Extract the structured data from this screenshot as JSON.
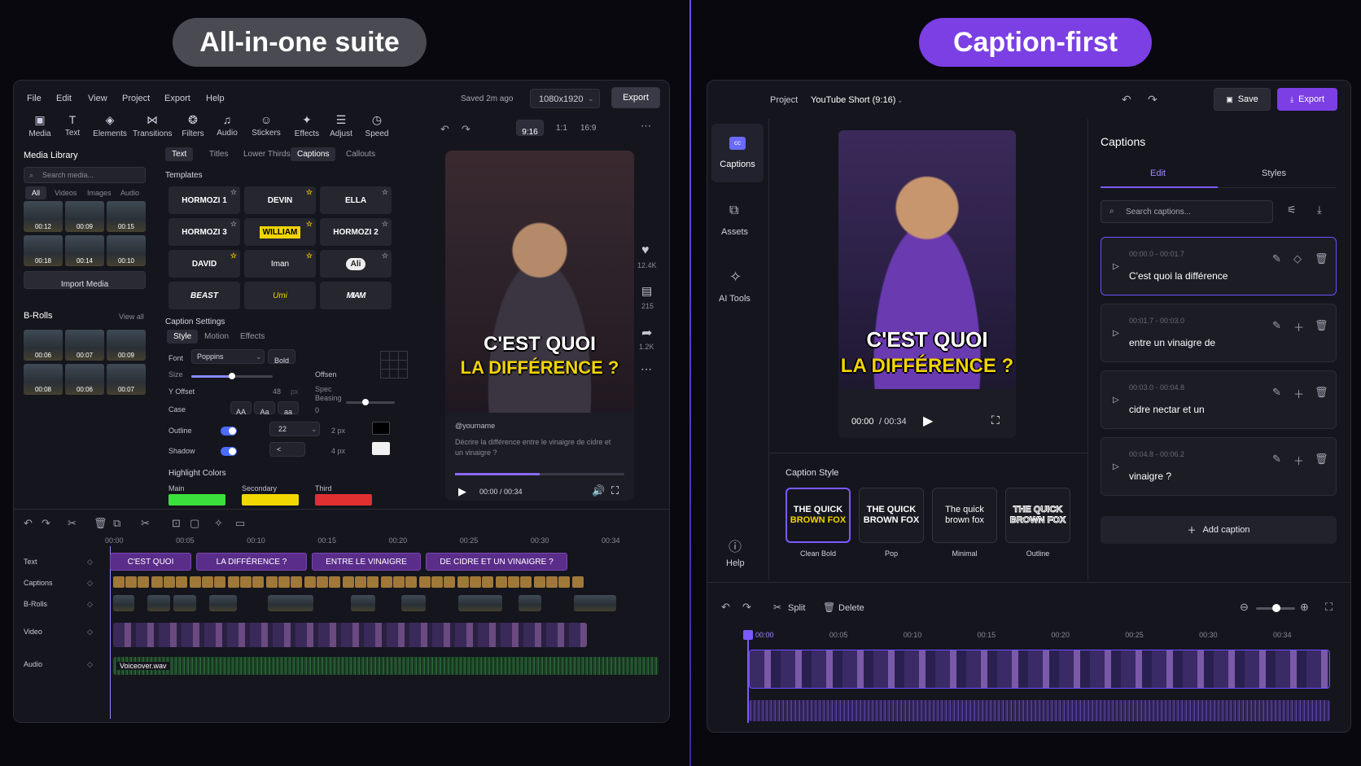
{
  "headers": {
    "left": "All-in-one suite",
    "right": "Caption-first"
  },
  "colors": {
    "accent": "#6a4fff",
    "accent_alt": "#7b3fe4",
    "main_highlight": "#3ce03c",
    "secondary_highlight": "#f0d800",
    "third_highlight": "#e03030"
  },
  "left": {
    "menu": [
      "File",
      "Edit",
      "View",
      "Project",
      "Export",
      "Help"
    ],
    "saved": "Saved 2m ago",
    "resolution": "1080x1920",
    "export_label": "Export",
    "tools": [
      {
        "label": "Media",
        "icon": "media-icon"
      },
      {
        "label": "Text",
        "icon": "text-icon"
      },
      {
        "label": "Elements",
        "icon": "elements-icon"
      },
      {
        "label": "Transitions",
        "icon": "transitions-icon"
      },
      {
        "label": "Filters",
        "icon": "filters-icon"
      },
      {
        "label": "Audio",
        "icon": "audio-icon"
      },
      {
        "label": "Stickers",
        "icon": "stickers-icon"
      },
      {
        "label": "Effects",
        "icon": "effects-icon"
      },
      {
        "label": "Adjust",
        "icon": "adjust-icon"
      },
      {
        "label": "Speed",
        "icon": "speed-icon"
      }
    ],
    "aspect": [
      "9:16",
      "1:1",
      "16:9"
    ],
    "media_library": {
      "title": "Media Library",
      "search_placeholder": "Search media...",
      "filters": [
        "All",
        "Videos",
        "Images",
        "Audio"
      ],
      "thumbs": [
        "00:12",
        "00:09",
        "00:15",
        "00:18",
        "00:14",
        "00:10"
      ],
      "import": "Import Media"
    },
    "brolls": {
      "title": "B-Rolls",
      "view_all": "View all",
      "thumbs": [
        "00:06",
        "00:07",
        "00:09",
        "00:08",
        "00:06",
        "00:07"
      ]
    },
    "text_tabs": [
      "Text",
      "Titles",
      "Lower Thirds",
      "Captions",
      "Callouts"
    ],
    "templates": {
      "title": "Templates",
      "items": [
        "HORMOZI 1",
        "DEVIN",
        "ELLA",
        "HORMOZI 3",
        "WILLIAM",
        "HORMOZI 2",
        "DAVID",
        "Iman",
        "Ali",
        "BEAST",
        "Umi",
        "MIAM"
      ]
    },
    "caption_settings": {
      "title": "Caption Settings",
      "tabs": [
        "Style",
        "Motion",
        "Effects"
      ],
      "font_label": "Font",
      "font_value": "Poppins",
      "bold": "Bold",
      "size_label": "Size",
      "size_value": 0.5,
      "offset_label": "Y Offset",
      "offset_value": "48",
      "offset_unit": "px",
      "offsen": "Offsen",
      "spacing_label": "Spec Beasing",
      "spacing_value": "0",
      "case_label": "Case",
      "case_options": [
        "AA",
        "Aa",
        "aa"
      ],
      "outline_label": "Outline",
      "outline_value": "22",
      "outline_px": "2 px",
      "shadow_label": "Shadow",
      "shadow_value": "<",
      "shadow_px": "4 px",
      "highlight_title": "Highlight Colors",
      "highlights": [
        "Main",
        "Secondary",
        "Third"
      ]
    },
    "preview": {
      "caption_line1": "C'EST QUOI",
      "caption_line2": "LA DIFFÉRENCE ?",
      "likes": "12.4K",
      "comments": "215",
      "shares": "1.2K",
      "handle": "@yourname",
      "description": "Décrire la différence entre le vinaigre de cidre et un vinaigre ?",
      "time": "00:00 / 00:34",
      "progress": 0.5
    },
    "timeline": {
      "ticks": [
        "00:00",
        "00:05",
        "00:10",
        "00:15",
        "00:20",
        "00:25",
        "00:30",
        "00:34"
      ],
      "tracks": [
        "Text",
        "Captions",
        "B-Rolls",
        "Video",
        "Audio"
      ],
      "text_clips": [
        "C'EST QUOI",
        "LA DIFFÉRENCE ?",
        "ENTRE LE VINAIGRE",
        "DE CIDRE ET UN VINAIGRE ?"
      ],
      "audio_file": "Voiceover.wav"
    }
  },
  "right": {
    "project_label": "Project",
    "project_name": "YouTube Short (9:16)",
    "save": "Save",
    "export": "Export",
    "sidebar": [
      {
        "label": "Captions",
        "icon": "captions-icon"
      },
      {
        "label": "Assets",
        "icon": "assets-icon"
      },
      {
        "label": "AI Tools",
        "icon": "ai-tools-icon"
      }
    ],
    "help": "Help",
    "preview": {
      "caption_line1": "C'EST QUOI",
      "caption_line2": "LA DIFFÉRENCE ?",
      "time_current": "00:00",
      "time_total": "/ 00:34"
    },
    "captions_panel": {
      "title": "Captions",
      "tabs": [
        "Edit",
        "Styles"
      ],
      "search_placeholder": "Search captions...",
      "items": [
        {
          "time": "00:00.0 - 00:01.7",
          "text": "C'est quoi la différence"
        },
        {
          "time": "00:01.7 - 00:03.0",
          "text": "entre un vinaigre de"
        },
        {
          "time": "00:03.0 - 00:04.8",
          "text": "cidre nectar et un"
        },
        {
          "time": "00:04.8 - 00:06.2",
          "text": "vinaigre ?"
        }
      ],
      "add": "Add caption"
    },
    "caption_style": {
      "title": "Caption Style",
      "options": [
        {
          "preview_top": "THE QUICK",
          "preview_bottom": "BROWN FOX",
          "label": "Clean Bold"
        },
        {
          "preview_top": "THE QUICK",
          "preview_bottom": "BROWN FOX",
          "label": "Pop"
        },
        {
          "preview_top": "The quick",
          "preview_bottom": "brown fox",
          "label": "Minimal"
        },
        {
          "preview_top": "THE QUICK",
          "preview_bottom": "BROWN FOX",
          "label": "Outline"
        }
      ]
    },
    "timeline": {
      "split": "Split",
      "delete": "Delete",
      "ticks": [
        "00:00",
        "00:05",
        "00:10",
        "00:15",
        "00:20",
        "00:25",
        "00:30",
        "00:34"
      ]
    }
  }
}
